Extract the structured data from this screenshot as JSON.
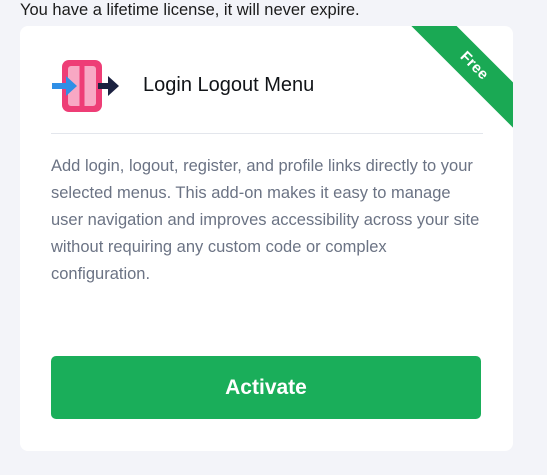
{
  "license_note": "You have a lifetime license, it will never expire.",
  "card": {
    "badge": "Free",
    "icon": "login-logout-icon",
    "title": "Login Logout Menu",
    "description": "Add login, logout, register, and profile links directly to your selected menus. This add-on makes it easy to manage user navigation and improves accessibility across your site without requiring any custom code or complex configuration.",
    "button_label": "Activate"
  },
  "colors": {
    "accent_green": "#1aae5a",
    "icon_pink": "#ee3d76",
    "icon_light_pink": "#f8a8c4",
    "arrow_blue": "#2f8fe6",
    "arrow_navy": "#1b2140"
  }
}
